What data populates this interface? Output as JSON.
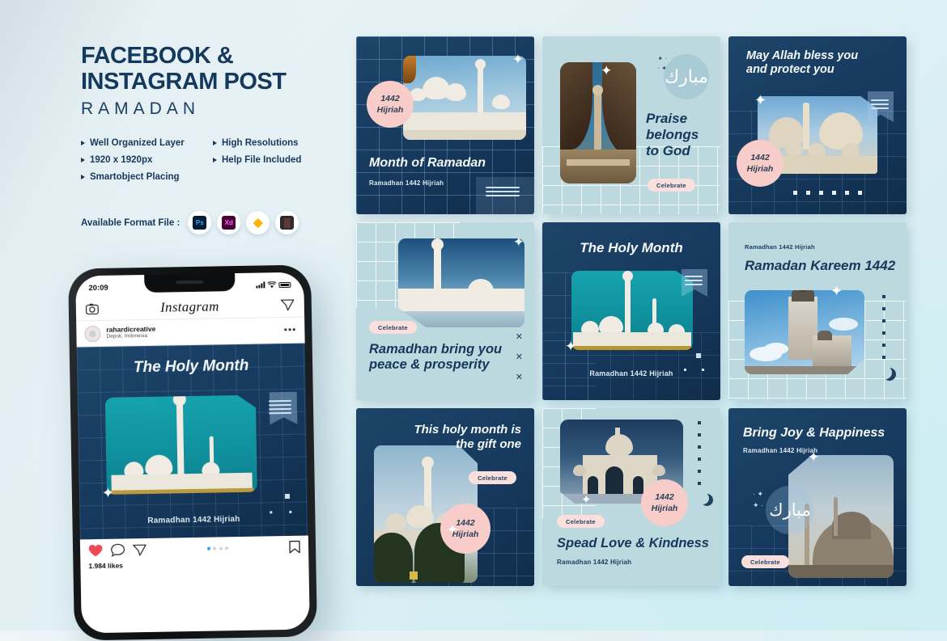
{
  "header": {
    "title_line1": "FACEBOOK &",
    "title_line2": "INSTAGRAM POST",
    "subtitle": "RAMADAN"
  },
  "features": [
    "Well Organized Layer",
    "High Resolutions",
    "1920 x 1920px",
    "Help File Included",
    "Smartobject Placing"
  ],
  "formats": {
    "label": "Available Format File  :",
    "items": [
      {
        "name": "photoshop-icon",
        "abbr": "Ps"
      },
      {
        "name": "adobe-xd-icon",
        "abbr": "Xd"
      },
      {
        "name": "sketch-icon",
        "abbr": "◆"
      },
      {
        "name": "figma-icon",
        "abbr": "▒"
      }
    ]
  },
  "phone": {
    "status_time": "20:09",
    "app_name": "Instagram",
    "username": "rahardicreative",
    "location": "Depok, Indonesia",
    "more_icon": "•••",
    "post_title": "The Holy Month",
    "post_caption": "Ramadhan 1442 Hijriah",
    "likes": "1.984 likes",
    "actions": [
      "heart-icon",
      "comment-icon",
      "share-icon",
      "bookmark-icon"
    ]
  },
  "colors": {
    "dark_navy": "#15395d",
    "light_blue": "#bcd9e0",
    "pink_badge": "#f7ccc9",
    "pink_pill": "#fadfdc",
    "teal": "#10919e",
    "page_bg": "#dff0f4"
  },
  "cards": [
    {
      "id": "month-of-ramadan",
      "theme": "dark",
      "title": "Month of Ramadan",
      "subtitle": "Ramadhan 1442 Hijriah",
      "badge_line1": "1442",
      "badge_line2": "Hijriah",
      "celebrate": null
    },
    {
      "id": "praise-belongs-to-god",
      "theme": "light",
      "title": "Praise\nbelongs\nto God",
      "subtitle": null,
      "badge_line1": null,
      "badge_line2": null,
      "celebrate": "Celebrate"
    },
    {
      "id": "may-allah-bless-you",
      "theme": "dark",
      "title": "May Allah bless you\nand protect you",
      "subtitle": null,
      "badge_line1": "1442",
      "badge_line2": "Hijriah",
      "celebrate": null
    },
    {
      "id": "ramadhan-bring-you-peace",
      "theme": "light",
      "title": "Ramadhan bring you\npeace & prosperity",
      "subtitle": null,
      "badge_line1": null,
      "badge_line2": null,
      "celebrate": "Celebrate"
    },
    {
      "id": "the-holy-month",
      "theme": "dark",
      "title": "The Holy Month",
      "subtitle": "Ramadhan 1442 Hijriah",
      "badge_line1": null,
      "badge_line2": null,
      "celebrate": null
    },
    {
      "id": "ramadan-kareem-1442",
      "theme": "light",
      "title": "Ramadan Kareem 1442",
      "subtitle": "Ramadhan 1442 Hijriah",
      "badge_line1": null,
      "badge_line2": null,
      "celebrate": null
    },
    {
      "id": "this-holy-month-is-the-gift-one",
      "theme": "dark",
      "title": "This holy month is\nthe gift one",
      "subtitle": null,
      "badge_line1": "1442",
      "badge_line2": "Hijriah",
      "celebrate": "Celebrate"
    },
    {
      "id": "spead-love-and-kindness",
      "theme": "light",
      "title": "Spead Love & Kindness",
      "subtitle": "Ramadhan 1442 Hijriah",
      "badge_line1": "1442",
      "badge_line2": "Hijriah",
      "celebrate": "Celebrate"
    },
    {
      "id": "bring-joy-and-happiness",
      "theme": "dark",
      "title": "Bring Joy & Happiness",
      "subtitle": "Ramadhan 1442 Hijriah",
      "badge_line1": null,
      "badge_line2": null,
      "celebrate": "Celebrate"
    }
  ]
}
